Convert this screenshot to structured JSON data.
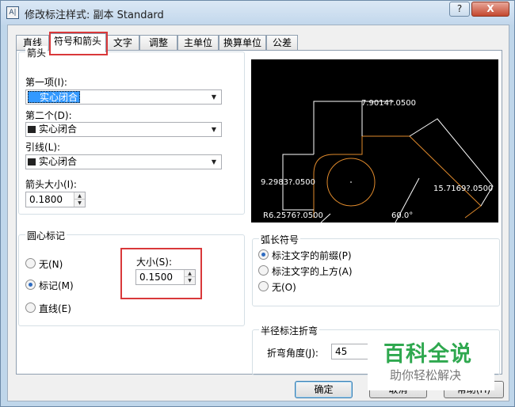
{
  "window": {
    "app_icon_text": "A|",
    "title": "修改标注样式: 副本 Standard",
    "help_button": "?",
    "close_button": "X"
  },
  "tabs": [
    {
      "label": "直线",
      "active": false
    },
    {
      "label": "符号和箭头",
      "active": true
    },
    {
      "label": "文字",
      "active": false
    },
    {
      "label": "调整",
      "active": false
    },
    {
      "label": "主单位",
      "active": false
    },
    {
      "label": "换算单位",
      "active": false
    },
    {
      "label": "公差",
      "active": false
    }
  ],
  "arrowheads": {
    "group_title": "箭头",
    "first_label": "第一项(I):",
    "first_value": "实心闭合",
    "second_label": "第二个(D):",
    "second_value": "实心闭合",
    "leader_label": "引线(L):",
    "leader_value": "实心闭合",
    "size_label": "箭头大小(I):",
    "size_value": "0.1800"
  },
  "center_marks": {
    "group_title": "圆心标记",
    "none_label": "无(N)",
    "mark_label": "标记(M)",
    "line_label": "直线(E)",
    "selected": "mark",
    "size_label": "大小(S):",
    "size_value": "0.1500"
  },
  "arc_length_symbol": {
    "group_title": "弧长符号",
    "prefix_label": "标注文字的前缀(P)",
    "above_label": "标注文字的上方(A)",
    "none_label": "无(O)",
    "selected": "prefix"
  },
  "radius_jog": {
    "group_title": "半径标注折弯",
    "angle_label": "折弯角度(J):",
    "angle_value": "45"
  },
  "preview": {
    "dim_top": "7.9014?.0500",
    "dim_left": "9.2983?.0500",
    "dim_right": "15.7169?.0500",
    "dim_angle": "60.0°",
    "dim_radius": "R6.2576?.0500"
  },
  "buttons": {
    "ok": "确定",
    "cancel": "取消",
    "help": "帮助(H)"
  },
  "watermark": {
    "title": "百科全说",
    "subtitle": "助你轻松解决"
  },
  "colors": {
    "title_bar": "#c2d7ec",
    "selection": "#3399ff",
    "highlight_box": "#d9383a",
    "preview_bg": "#000000",
    "preview_line": "#ffffff",
    "preview_shape": "#e08a2c",
    "watermark_green": "#2fa84f"
  }
}
